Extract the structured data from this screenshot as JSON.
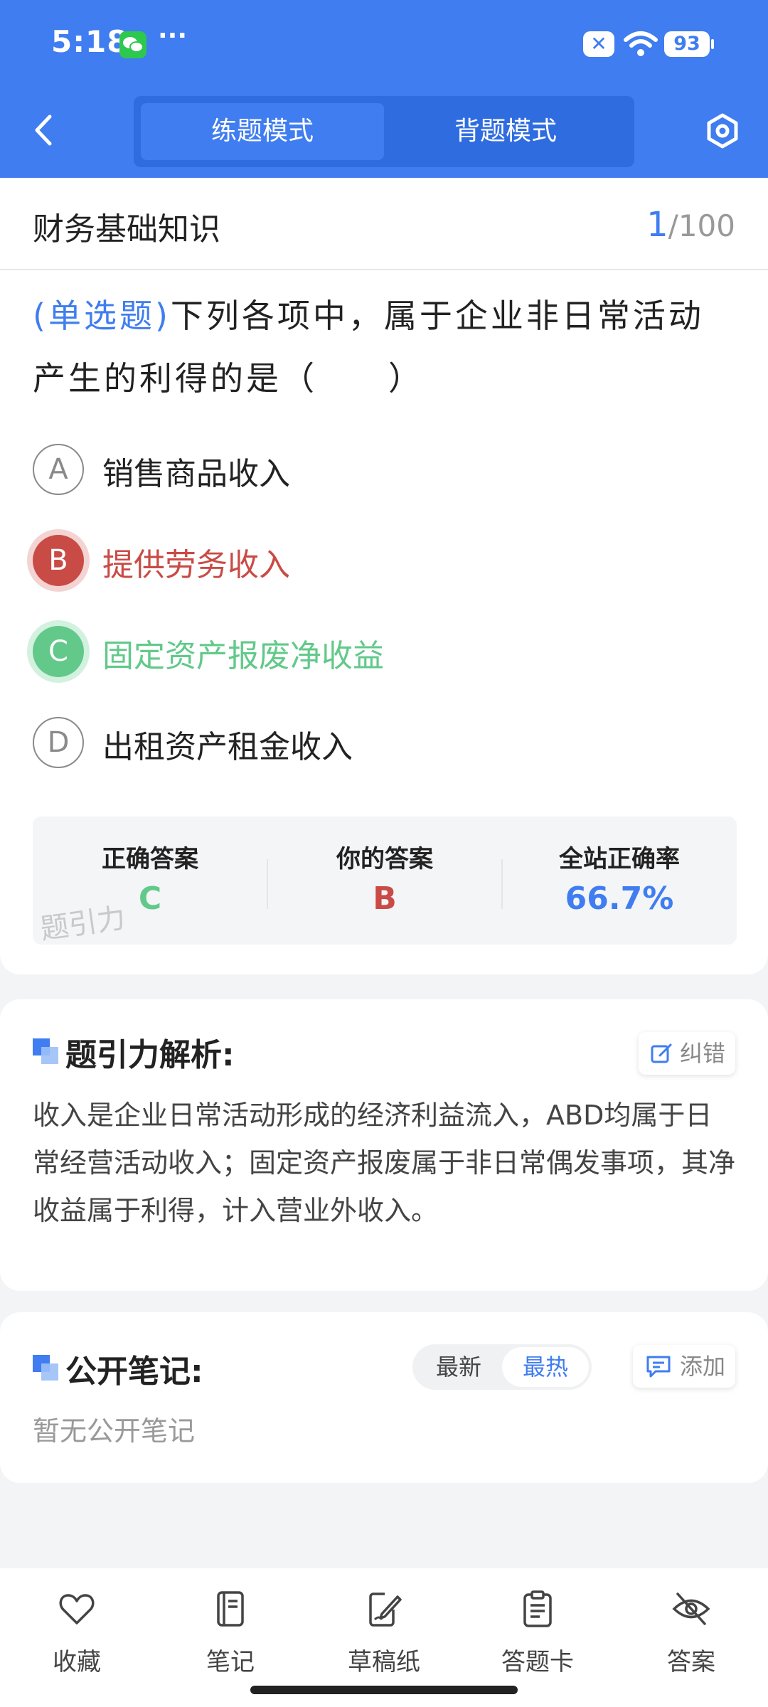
{
  "status_bar": {
    "time": "5:18",
    "more": "···",
    "battery": "93"
  },
  "header": {
    "tabs": [
      {
        "label": "练题模式",
        "active": true
      },
      {
        "label": "背题模式",
        "active": false
      }
    ]
  },
  "subject": {
    "title": "财务基础知识",
    "current": "1",
    "total": "/100"
  },
  "question": {
    "type": "(单选题)",
    "text": "下列各项中，属于企业非日常活动产生的利得的是（　　）",
    "options": [
      {
        "key": "A",
        "text": "销售商品收入",
        "state": "normal"
      },
      {
        "key": "B",
        "text": "提供劳务收入",
        "state": "wrong"
      },
      {
        "key": "C",
        "text": "固定资产报废净收益",
        "state": "correct"
      },
      {
        "key": "D",
        "text": "出租资产租金收入",
        "state": "normal"
      }
    ]
  },
  "answer_summary": {
    "correct_label": "正确答案",
    "correct_value": "C",
    "yours_label": "你的答案",
    "yours_value": "B",
    "rate_label": "全站正确率",
    "rate_value": "66.7%",
    "watermark": "题引力"
  },
  "analysis": {
    "title": "题引力解析:",
    "report_label": "纠错",
    "text": "收入是企业日常活动形成的经济利益流入，ABD均属于日常经营活动收入；固定资产报废属于非日常偶发事项，其净收益属于利得，计入营业外收入。"
  },
  "notes": {
    "title": "公开笔记:",
    "sort_options": [
      {
        "label": "最新",
        "active": false
      },
      {
        "label": "最热",
        "active": true
      }
    ],
    "add_label": "添加",
    "empty_text": "暂无公开笔记"
  },
  "bottom_nav": [
    {
      "label": "收藏",
      "icon": "heart-icon"
    },
    {
      "label": "笔记",
      "icon": "notebook-icon"
    },
    {
      "label": "草稿纸",
      "icon": "draft-icon"
    },
    {
      "label": "答题卡",
      "icon": "answer-card-icon"
    },
    {
      "label": "答案",
      "icon": "eye-off-icon"
    }
  ],
  "colors": {
    "primary": "#3f7df0",
    "wrong": "#c94b46",
    "correct": "#62c98a"
  }
}
